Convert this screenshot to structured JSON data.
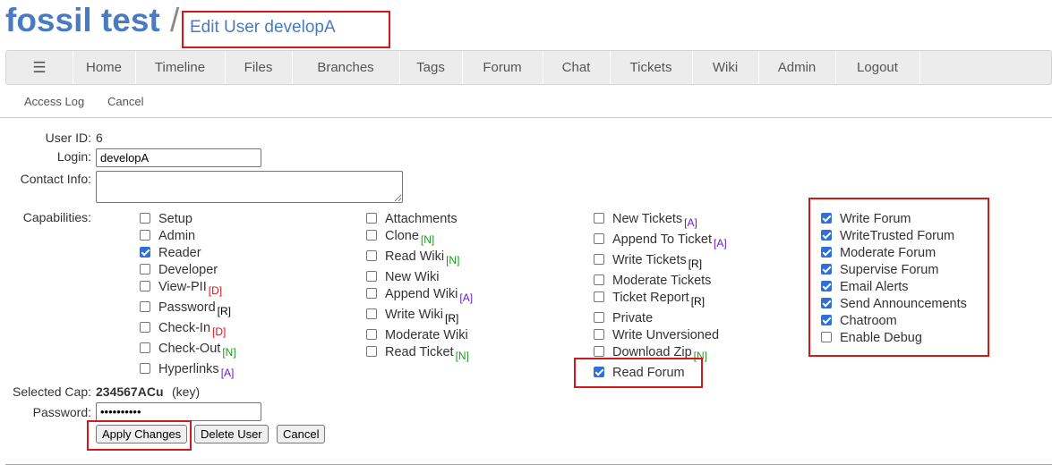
{
  "header": {
    "site_title": "fossil test",
    "separator": "/",
    "page_title": "Edit User developA"
  },
  "nav": {
    "menu_icon": "☰",
    "items": [
      "Home",
      "Timeline",
      "Files",
      "Branches",
      "Tags",
      "Forum",
      "Chat",
      "Tickets",
      "Wiki",
      "Admin",
      "Logout"
    ]
  },
  "subnav": {
    "items": [
      "Access Log",
      "Cancel"
    ]
  },
  "form": {
    "user_id_label": "User ID:",
    "user_id_value": "6",
    "login_label": "Login:",
    "login_value": "developA",
    "contact_label": "Contact Info:",
    "contact_value": "",
    "capabilities_label": "Capabilities:",
    "selected_cap_label": "Selected Cap:",
    "selected_cap_value": "234567ACu",
    "selected_cap_key": "(key)",
    "password_label": "Password:",
    "password_value": "••••••••••",
    "buttons": {
      "apply": "Apply Changes",
      "delete": "Delete User",
      "cancel": "Cancel"
    }
  },
  "capabilities": {
    "col1": [
      {
        "label": "Setup",
        "checked": false,
        "tag": ""
      },
      {
        "label": "Admin",
        "checked": false,
        "tag": ""
      },
      {
        "label": "Reader",
        "checked": true,
        "tag": ""
      },
      {
        "label": "Developer",
        "checked": false,
        "tag": ""
      },
      {
        "label": "View-PII",
        "checked": false,
        "tag": "[D]"
      },
      {
        "label": "Password",
        "checked": false,
        "tag": "[R]"
      },
      {
        "label": "Check-In",
        "checked": false,
        "tag": "[D]"
      },
      {
        "label": "Check-Out",
        "checked": false,
        "tag": "[N]"
      },
      {
        "label": "Hyperlinks",
        "checked": false,
        "tag": "[A]"
      }
    ],
    "col2": [
      {
        "label": "Attachments",
        "checked": false,
        "tag": ""
      },
      {
        "label": "Clone",
        "checked": false,
        "tag": "[N]"
      },
      {
        "label": "Read Wiki",
        "checked": false,
        "tag": "[N]"
      },
      {
        "label": "New Wiki",
        "checked": false,
        "tag": ""
      },
      {
        "label": "Append Wiki",
        "checked": false,
        "tag": "[A]"
      },
      {
        "label": "Write Wiki",
        "checked": false,
        "tag": "[R]"
      },
      {
        "label": "Moderate Wiki",
        "checked": false,
        "tag": ""
      },
      {
        "label": "Read Ticket",
        "checked": false,
        "tag": "[N]"
      }
    ],
    "col3": [
      {
        "label": "New Tickets",
        "checked": false,
        "tag": "[A]"
      },
      {
        "label": "Append To Ticket",
        "checked": false,
        "tag": "[A]"
      },
      {
        "label": "Write Tickets",
        "checked": false,
        "tag": "[R]"
      },
      {
        "label": "Moderate Tickets",
        "checked": false,
        "tag": ""
      },
      {
        "label": "Ticket Report",
        "checked": false,
        "tag": "[R]"
      },
      {
        "label": "Private",
        "checked": false,
        "tag": ""
      },
      {
        "label": "Write Unversioned",
        "checked": false,
        "tag": ""
      },
      {
        "label": "Download Zip",
        "checked": false,
        "tag": "[N]"
      },
      {
        "label": "Read Forum",
        "checked": true,
        "tag": ""
      }
    ],
    "col4": [
      {
        "label": "Write Forum",
        "checked": true,
        "tag": ""
      },
      {
        "label": "WriteTrusted Forum",
        "checked": true,
        "tag": ""
      },
      {
        "label": "Moderate Forum",
        "checked": true,
        "tag": ""
      },
      {
        "label": "Supervise Forum",
        "checked": true,
        "tag": ""
      },
      {
        "label": "Email Alerts",
        "checked": true,
        "tag": ""
      },
      {
        "label": "Send Announcements",
        "checked": true,
        "tag": ""
      },
      {
        "label": "Chatroom",
        "checked": true,
        "tag": ""
      },
      {
        "label": "Enable Debug",
        "checked": false,
        "tag": ""
      }
    ]
  },
  "tag_colors": {
    "[D]": "#e01010",
    "[R]": "#000000",
    "[N]": "#1a9a1a",
    "[A]": "#6a1ad0"
  }
}
